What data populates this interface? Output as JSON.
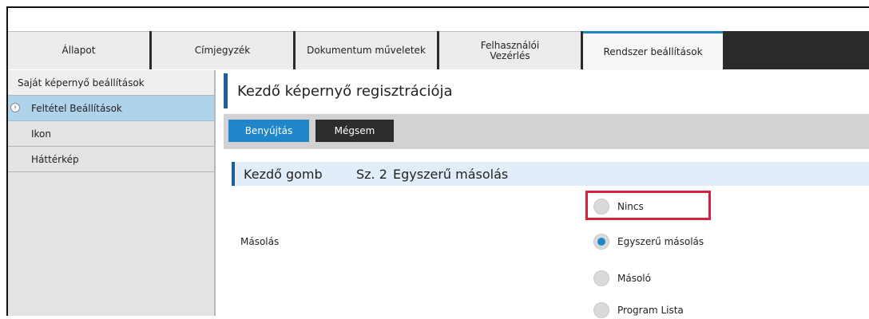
{
  "tabs": [
    {
      "label": "Állapot"
    },
    {
      "label": "Címjegyzék"
    },
    {
      "label": "Dokumentum műveletek"
    },
    {
      "label_line1": "Felhasználói",
      "label_line2": "Vezérlés"
    },
    {
      "label": "Rendszer beállítások",
      "active": true
    }
  ],
  "sidebar": {
    "header": "Saját képernyő beállítások",
    "items": [
      {
        "label": "Feltétel Beállítások",
        "selected": true,
        "icon": "chevron-right-circle-icon"
      },
      {
        "label": "Ikon"
      },
      {
        "label": "Háttérkép"
      }
    ]
  },
  "main": {
    "title": "Kezdő képernyő regisztrációja",
    "buttons": {
      "submit": "Benyújtás",
      "cancel": "Mégsem"
    },
    "section": {
      "label": "Kezdő gomb",
      "number": "Sz. 2",
      "value": "Egyszerű másolás"
    },
    "field_label": "Másolás",
    "options": [
      {
        "label": "Nincs",
        "selected": false,
        "highlighted": true
      },
      {
        "label": "Egyszerű másolás",
        "selected": true
      },
      {
        "label": "Másoló",
        "selected": false
      },
      {
        "label": "Program Lista",
        "selected": false
      }
    ]
  },
  "colors": {
    "accent_blue": "#1f87c9",
    "dark_accent": "#1d5e9c",
    "highlight_red": "#d6213f",
    "sidebar_selected": "#b0d3ec",
    "section_bg": "#e1eefa"
  }
}
